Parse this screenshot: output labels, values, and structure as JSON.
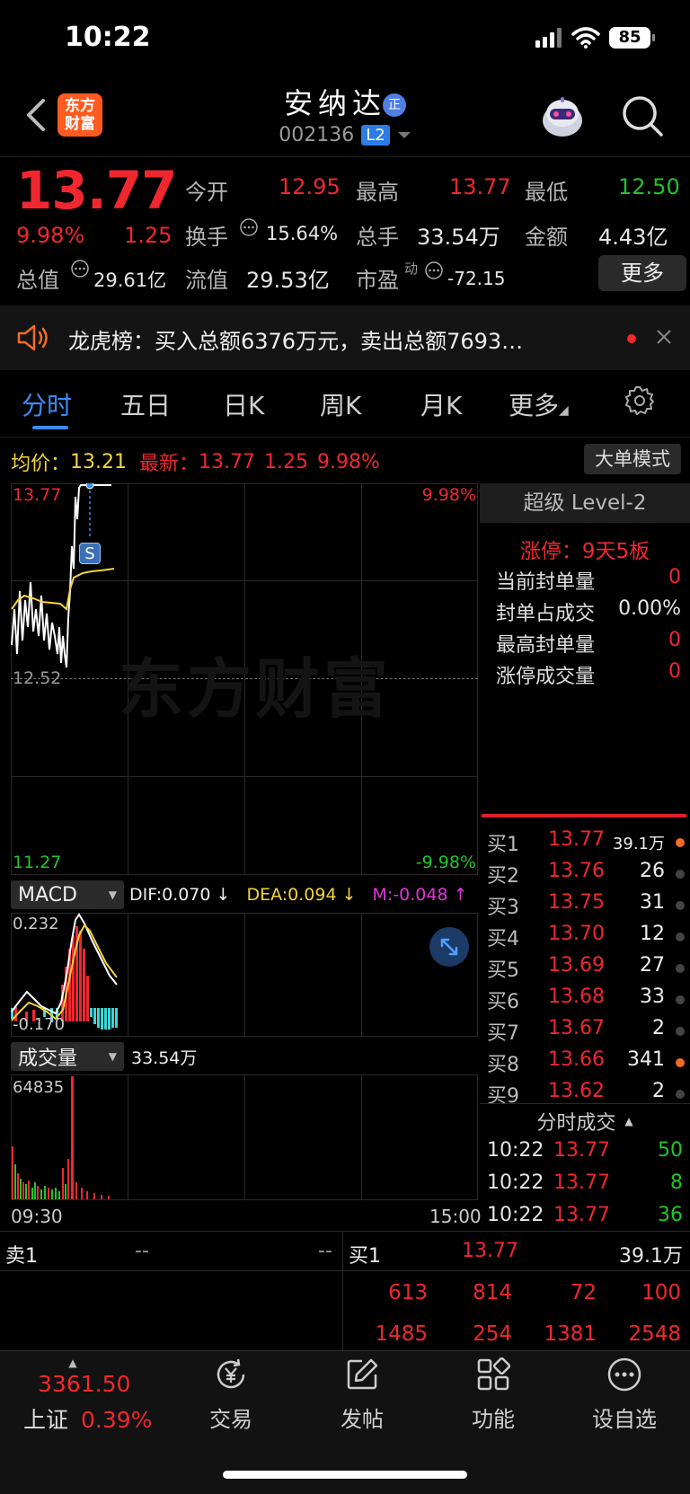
{
  "status": {
    "time": "10:22",
    "battery": "85"
  },
  "header": {
    "logo_line1": "东方",
    "logo_line2": "财富",
    "stock_name": "安纳达",
    "stock_badge": "正",
    "stock_code": "002136",
    "level_badge": "L2"
  },
  "quote": {
    "price": "13.77",
    "change_pct": "9.98%",
    "change_amt": "1.25",
    "open_label": "今开",
    "open": "12.95",
    "high_label": "最高",
    "high": "13.77",
    "low_label": "最低",
    "low": "12.50",
    "turnover_label": "换手",
    "turnover": "15.64%",
    "volume_label": "总手",
    "volume": "33.54万",
    "amount_label": "金额",
    "amount": "4.43亿",
    "mktcap_label": "总值",
    "mktcap": "29.61亿",
    "float_label": "流值",
    "float": "29.53亿",
    "pe_label": "市盈",
    "pe_sup": "动",
    "pe": "-72.15",
    "more_label": "更多"
  },
  "notice": {
    "text": "龙虎榜：买入总额6376万元，卖出总额7693…"
  },
  "tabs": [
    "分时",
    "五日",
    "日K",
    "周K",
    "月K",
    "更多"
  ],
  "chart_info": {
    "avg_label": "均价：",
    "avg": "13.21",
    "latest_label": "最新：",
    "latest": "13.77",
    "latest_chg": "1.25",
    "latest_pct": "9.98%",
    "mode_button": "大单模式",
    "y_top": "13.77",
    "y_mid": "12.52",
    "y_bottom": "11.27",
    "pct_top": "9.98%",
    "pct_bottom": "-9.98%",
    "s_marker": "S",
    "watermark": "东方财富"
  },
  "macd": {
    "selector": "MACD",
    "dif": "DIF:0.070 ↓",
    "dea": "DEA:0.094 ↓",
    "m": "M:-0.048 ↑",
    "y_top": "0.232",
    "y_bottom": "-0.170"
  },
  "volume": {
    "selector": "成交量",
    "value": "33.54万",
    "y_top": "64835",
    "t_start": "09:30",
    "t_end": "15:00"
  },
  "level2": {
    "title": "超级 Level-2",
    "limit_label": "涨停：9天5板",
    "rows": [
      {
        "label": "当前封单量",
        "value": "0"
      },
      {
        "label": "封单占成交",
        "value": "0.00%"
      },
      {
        "label": "最高封单量",
        "value": "0"
      },
      {
        "label": "涨停成交量",
        "value": "0"
      }
    ]
  },
  "order_book": [
    {
      "label": "买1",
      "price": "13.77",
      "vol": "39.1万",
      "dot": "orange"
    },
    {
      "label": "买2",
      "price": "13.76",
      "vol": "26",
      "dot": "gray"
    },
    {
      "label": "买3",
      "price": "13.75",
      "vol": "31",
      "dot": "gray"
    },
    {
      "label": "买4",
      "price": "13.70",
      "vol": "12",
      "dot": "gray"
    },
    {
      "label": "买5",
      "price": "13.69",
      "vol": "27",
      "dot": "gray"
    },
    {
      "label": "买6",
      "price": "13.68",
      "vol": "33",
      "dot": "gray"
    },
    {
      "label": "买7",
      "price": "13.67",
      "vol": "2",
      "dot": "gray"
    },
    {
      "label": "买8",
      "price": "13.66",
      "vol": "341",
      "dot": "orange"
    },
    {
      "label": "买9",
      "price": "13.62",
      "vol": "2",
      "dot": "gray"
    }
  ],
  "ticks": {
    "title": "分时成交",
    "rows": [
      {
        "time": "10:22",
        "price": "13.77",
        "vol": "50"
      },
      {
        "time": "10:22",
        "price": "13.77",
        "vol": "8"
      },
      {
        "time": "10:22",
        "price": "13.77",
        "vol": "36"
      }
    ]
  },
  "queue": {
    "sell_label": "卖1",
    "sell_price": "--",
    "sell_vol": "--",
    "buy_label": "买1",
    "buy_price": "13.77",
    "buy_vol": "39.1万",
    "row1": [
      "613",
      "814",
      "72",
      "100"
    ],
    "row2": [
      "1485",
      "254",
      "1381",
      "2548"
    ]
  },
  "bottom_nav": {
    "index_value": "3361.50",
    "index_name": "上证",
    "index_pct": "0.39%",
    "items": [
      "交易",
      "发帖",
      "功能",
      "设自选"
    ]
  },
  "colors": {
    "up": "#f0272f",
    "down": "#22c42a",
    "avg_line": "#f5d33c",
    "accent": "#3b8cf7"
  }
}
